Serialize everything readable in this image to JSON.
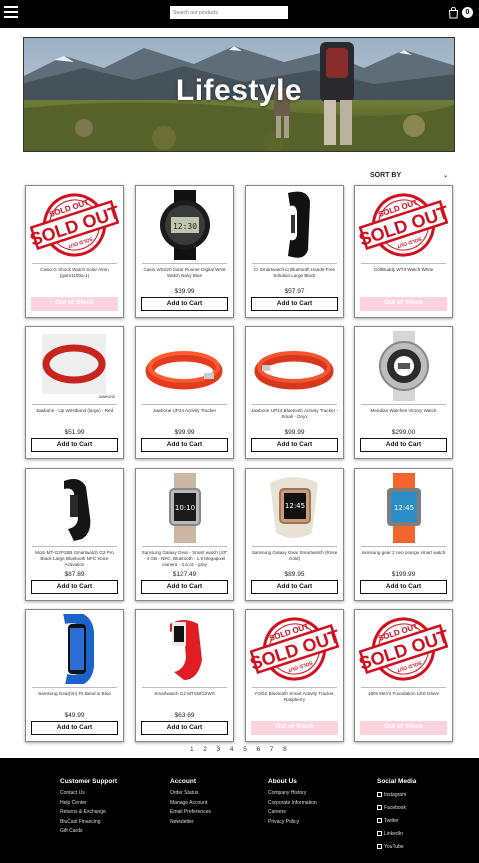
{
  "header": {
    "search_placeholder": "Search our products",
    "cart_count": "0"
  },
  "hero": {
    "title": "Lifestyle"
  },
  "sort": {
    "label": "SORT BY"
  },
  "products": [
    {
      "name": "Casio G Shock Watch Solar Atom (gwm1100a-1)",
      "price": "",
      "button": "Out of Stock",
      "stock": "out"
    },
    {
      "name": "Casio WS220 Solar Runner Digital Wrist Watch Navy Blue",
      "price": "$39.99",
      "button": "Add to Cart",
      "stock": "in"
    },
    {
      "name": "CI Smartwatch.io Bluetooth Hands-Free Solution Large Black",
      "price": "$57.97",
      "button": "Add to Cart",
      "stock": "in"
    },
    {
      "name": "GolfBuddy WT3 Watch White",
      "price": "",
      "button": "Out of Stock",
      "stock": "out"
    },
    {
      "name": "Jawbone - Up Wristband (large) - Red",
      "price": "$51.99",
      "button": "Add to Cart",
      "stock": "in"
    },
    {
      "name": "Jawbone UP24 Activity Tracker",
      "price": "$99.99",
      "button": "Add to Cart",
      "stock": "in"
    },
    {
      "name": "Jawbone UP24 Bluetooth Activity Tracker - Small - Onyx",
      "price": "$99.99",
      "button": "Add to Cart",
      "stock": "in"
    },
    {
      "name": "Meridian Watches Victory Watch",
      "price": "$299.00",
      "button": "Add to Cart",
      "stock": "in"
    },
    {
      "name": "Moto MT-G2P1BB Smartwatch G2 Pro Black Large Bluetooth NFC Voice Activation",
      "price": "$87.89",
      "button": "Add to Cart",
      "stock": "in"
    },
    {
      "name": "Samsung Galaxy Gear - Smart watch (43\" - 4 GB - NFC, Bluetooth - 1.9 Megapixel camera - 3.6 oz - gray",
      "price": "$127.49",
      "button": "Add to Cart",
      "stock": "in"
    },
    {
      "name": "Samsung Galaxy Gear Smartwatch (Rose Gold)",
      "price": "$89.95",
      "button": "Add to Cart",
      "stock": "in"
    },
    {
      "name": "samsung gear 2 neo orange smart watch",
      "price": "$199.99",
      "button": "Add to Cart",
      "stock": "in"
    },
    {
      "name": "Samsung Gear(tm) Fit Band in Blue",
      "price": "$49.99",
      "button": "Add to Cart",
      "stock": "in"
    },
    {
      "name": "Smartwatch G2 MTSWG2WS",
      "price": "$63.69",
      "button": "Add to Cart",
      "stock": "in"
    },
    {
      "name": "YOOZ Bluetooth Smart Activity Tracker, Raspberry",
      "price": "",
      "button": "Out of Stock",
      "stock": "out"
    },
    {
      "name": "180s Men's Foundation LED Glove",
      "price": "",
      "button": "Out of Stock",
      "stock": "out"
    }
  ],
  "sold_out": {
    "top": "SOLD OUT",
    "main": "SOLD OUT",
    "bottom": "SOLD OUT"
  },
  "pagination": [
    "1",
    "2",
    "3",
    "4",
    "5",
    "6",
    "7",
    "8"
  ],
  "footer": {
    "customer_support": {
      "title": "Customer Support",
      "links": [
        "Contact Us",
        "Help Center",
        "Returns & Exchange",
        "BluCast Financing",
        "Gift Cards"
      ]
    },
    "account": {
      "title": "Account",
      "links": [
        "Order Status",
        "Manage Account",
        "Email Preferences",
        "Newsletter"
      ]
    },
    "about": {
      "title": "About Us",
      "links": [
        "Company History",
        "Corporate Information",
        "Careers",
        "Privacy Policy"
      ]
    },
    "social": {
      "title": "Social Media",
      "links": [
        "Instagram",
        "Facebook",
        "Twitter",
        "LinkedIn",
        "YouTube"
      ]
    }
  },
  "colors": {
    "topbar": "#000000",
    "footer": "#000000",
    "sold_out_red": "#d0101e",
    "oos_button": "#fbd3dc"
  },
  "icons": {
    "menu": "hamburger-icon",
    "cart": "shopping-bag-icon"
  }
}
